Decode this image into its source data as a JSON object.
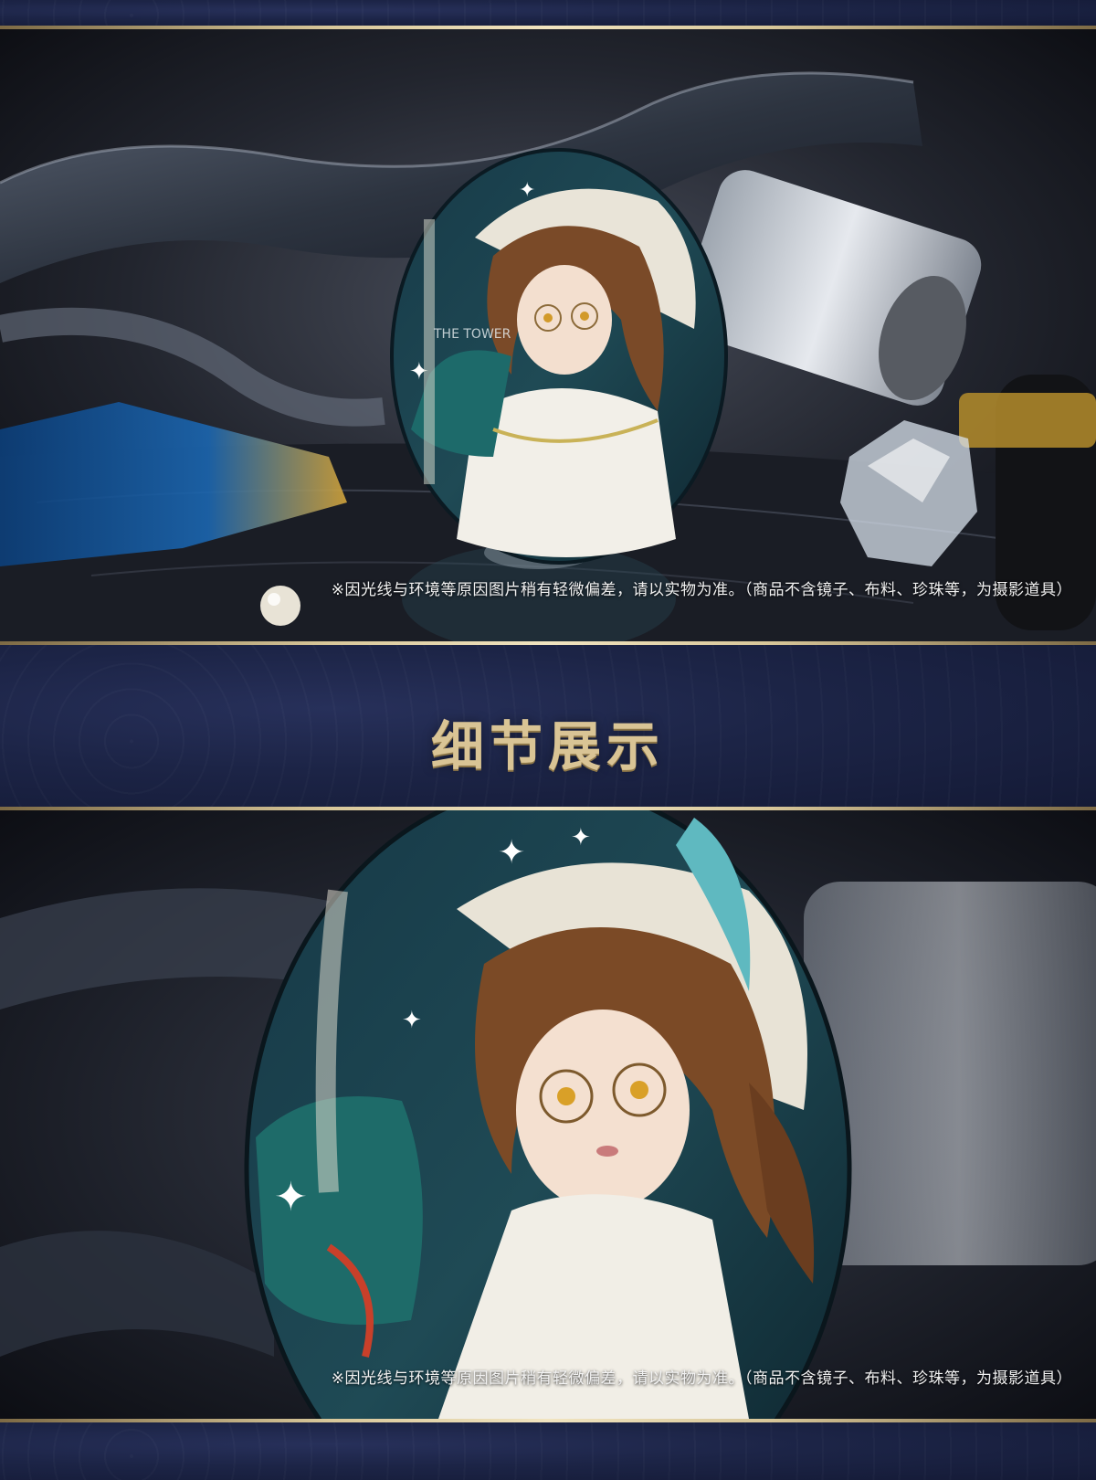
{
  "section": {
    "title": "细节展示"
  },
  "photos": [
    {
      "disclaimer": "※因光线与环境等原因图片稍有轻微偏差，请以实物为准。（商品不含镜子、布料、珍珠等，为摄影道具）"
    },
    {
      "disclaimer": "※因光线与环境等原因图片稍有轻微偏差，请以实物为准。（商品不含镜子、布料、珍珠等，为摄影道具）"
    }
  ],
  "badge_art": {
    "text_on_badge": "THE TOWER"
  },
  "colors": {
    "navy_background": "#1b2342",
    "gold_accent": "#d9c495",
    "badge_teal": "#1f4a55"
  }
}
